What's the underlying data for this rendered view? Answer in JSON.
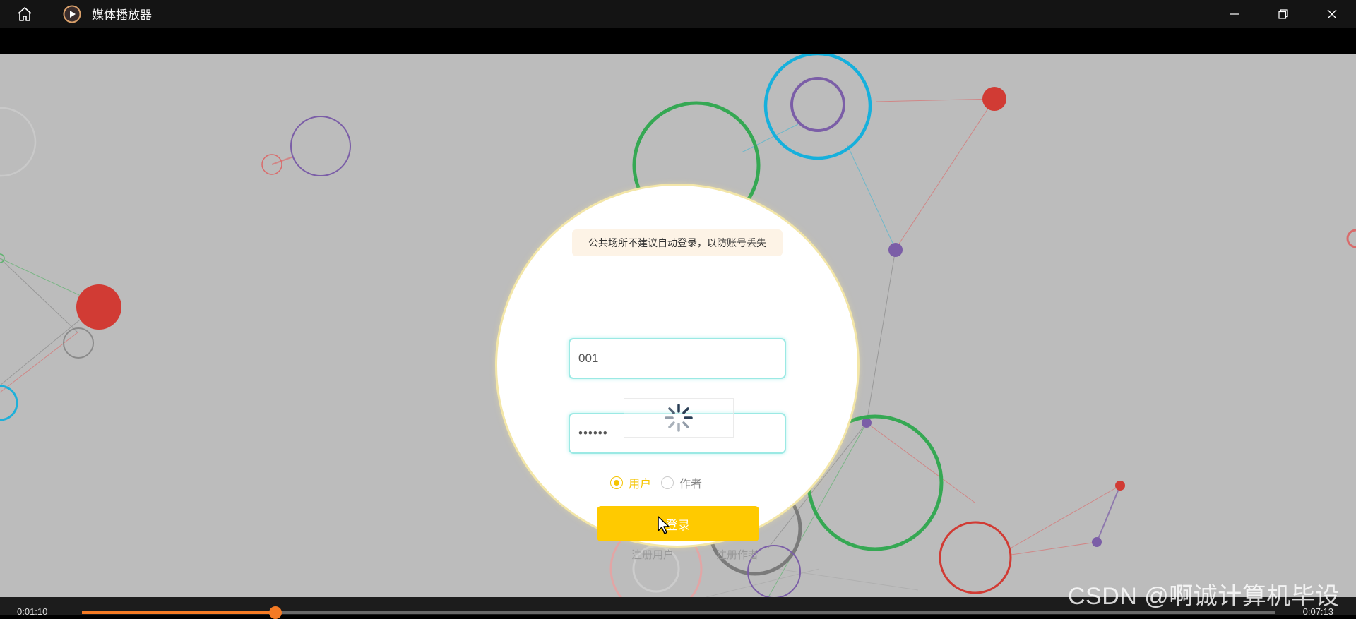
{
  "window": {
    "title": "媒体播放器",
    "icons": {
      "home": "home-icon",
      "app": "play-icon",
      "minimize": "minimize-icon",
      "restore": "restore-icon",
      "close": "close-icon"
    }
  },
  "login": {
    "notice": "公共场所不建议自动登录，以防账号丢失",
    "username_value": "001",
    "password_value": "••••••",
    "roles": [
      {
        "label": "用户",
        "selected": true
      },
      {
        "label": "作者",
        "selected": false
      }
    ],
    "submit_label": "登录",
    "register_user": "注册用户",
    "register_author": "注册作者",
    "loading_icon": "spinner-icon",
    "accent": "#ffca00"
  },
  "player": {
    "current_time": "0:01:10",
    "total_time": "0:07:13",
    "progress_fraction": 0.162,
    "accent": "#f47a24"
  },
  "watermark": "CSDN @啊诚计算机毕设"
}
